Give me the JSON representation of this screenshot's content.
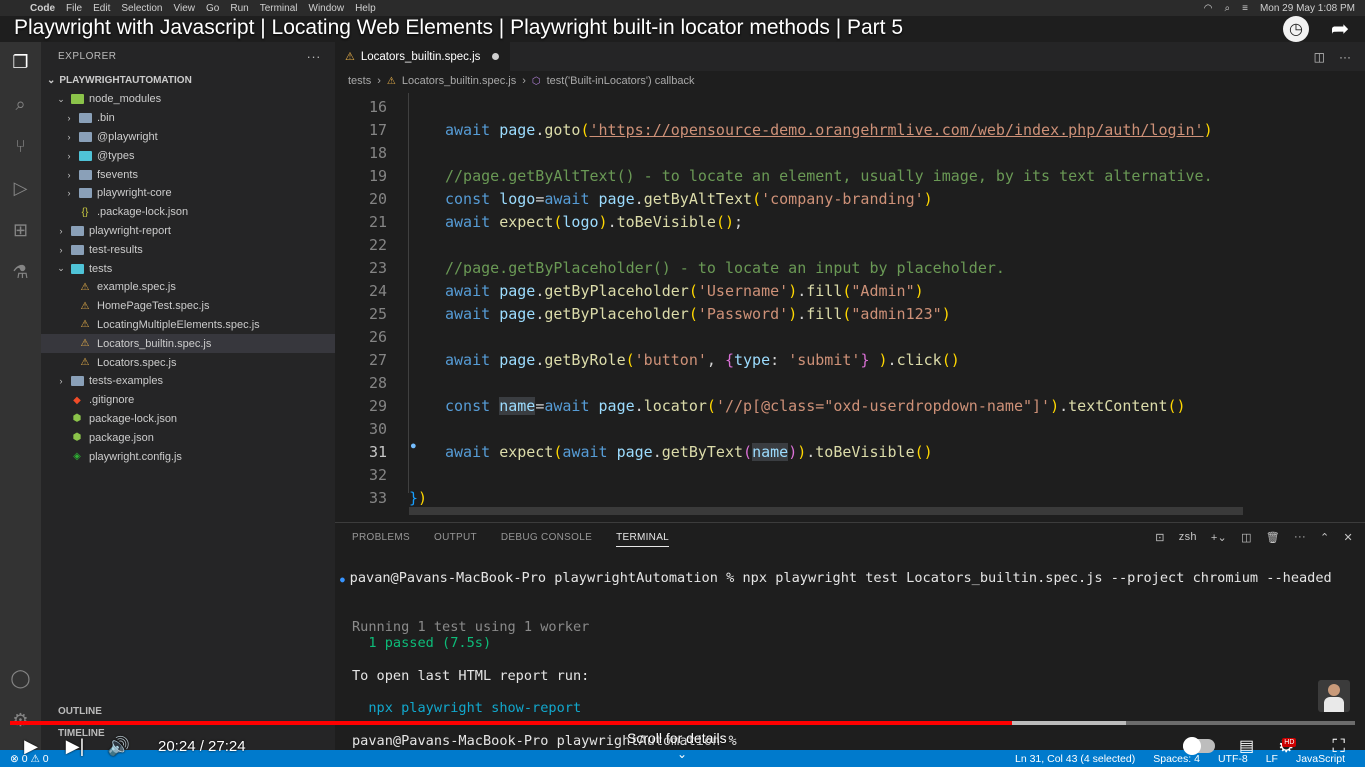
{
  "menubar": {
    "app": "Code",
    "items": [
      "File",
      "Edit",
      "Selection",
      "View",
      "Go",
      "Run",
      "Terminal",
      "Window",
      "Help"
    ],
    "datetime": "Mon 29 May  1:08 PM"
  },
  "video": {
    "title": "Playwright with Javascript | Locating Web Elements | Playwright built-in locator methods | Part 5",
    "current_time": "20:24",
    "duration": "27:24",
    "time_display": "20:24 / 27:24",
    "progress": 0.745,
    "buffered": 0.83,
    "scroll_hint": "Scroll for details",
    "hd_badge": "HD"
  },
  "explorer": {
    "header": "EXPLORER",
    "project": "PLAYWRIGHTAUTOMATION",
    "items": [
      {
        "label": "node_modules",
        "depth": 1,
        "kind": "folder-green",
        "chev": "open"
      },
      {
        "label": ".bin",
        "depth": 2,
        "kind": "folder",
        "chev": "closed"
      },
      {
        "label": "@playwright",
        "depth": 2,
        "kind": "folder",
        "chev": "closed"
      },
      {
        "label": "@types",
        "depth": 2,
        "kind": "folder-teal",
        "chev": "closed"
      },
      {
        "label": "fsevents",
        "depth": 2,
        "kind": "folder",
        "chev": "closed"
      },
      {
        "label": "playwright-core",
        "depth": 2,
        "kind": "folder",
        "chev": "closed"
      },
      {
        "label": ".package-lock.json",
        "depth": 2,
        "kind": "json",
        "chev": "none"
      },
      {
        "label": "playwright-report",
        "depth": 1,
        "kind": "folder",
        "chev": "closed"
      },
      {
        "label": "test-results",
        "depth": 1,
        "kind": "folder",
        "chev": "closed"
      },
      {
        "label": "tests",
        "depth": 1,
        "kind": "folder-teal",
        "chev": "open"
      },
      {
        "label": "example.spec.js",
        "depth": 2,
        "kind": "test",
        "chev": "none"
      },
      {
        "label": "HomePageTest.spec.js",
        "depth": 2,
        "kind": "test",
        "chev": "none"
      },
      {
        "label": "LocatingMultipleElements.spec.js",
        "depth": 2,
        "kind": "test",
        "chev": "none"
      },
      {
        "label": "Locators_builtin.spec.js",
        "depth": 2,
        "kind": "test",
        "chev": "none",
        "selected": true
      },
      {
        "label": "Locators.spec.js",
        "depth": 2,
        "kind": "test",
        "chev": "none"
      },
      {
        "label": "tests-examples",
        "depth": 1,
        "kind": "folder",
        "chev": "closed"
      },
      {
        "label": ".gitignore",
        "depth": 1,
        "kind": "git",
        "chev": "none"
      },
      {
        "label": "package-lock.json",
        "depth": 1,
        "kind": "npm",
        "chev": "none"
      },
      {
        "label": "package.json",
        "depth": 1,
        "kind": "npm",
        "chev": "none"
      },
      {
        "label": "playwright.config.js",
        "depth": 1,
        "kind": "pw",
        "chev": "none"
      }
    ],
    "outline": "OUTLINE",
    "timeline": "TIMELINE"
  },
  "editor": {
    "tab_label": "Locators_builtin.spec.js",
    "breadcrumb": [
      "tests",
      "Locators_builtin.spec.js",
      "test('Built-inLocators') callback"
    ]
  },
  "code_lines": [
    {
      "n": "16",
      "tokens": []
    },
    {
      "n": "17",
      "tokens": [
        [
          "k",
          "await "
        ],
        [
          "v",
          "page"
        ],
        [
          "p",
          "."
        ],
        [
          "f",
          "goto"
        ],
        [
          "b1",
          "("
        ],
        [
          "su",
          "'https://opensource-demo.orangehrmlive.com/web/index.php/auth/login'"
        ],
        [
          "b1",
          ")"
        ]
      ]
    },
    {
      "n": "18",
      "tokens": []
    },
    {
      "n": "19",
      "tokens": [
        [
          "c",
          "//page.getByAltText() - to locate an element, usually image, by its text alternative."
        ]
      ]
    },
    {
      "n": "20",
      "tokens": [
        [
          "k",
          "const "
        ],
        [
          "v",
          "logo"
        ],
        [
          "p",
          "="
        ],
        [
          "k",
          "await "
        ],
        [
          "v",
          "page"
        ],
        [
          "p",
          "."
        ],
        [
          "f",
          "getByAltText"
        ],
        [
          "b1",
          "("
        ],
        [
          "s",
          "'company-branding'"
        ],
        [
          "b1",
          ")"
        ]
      ]
    },
    {
      "n": "21",
      "tokens": [
        [
          "k",
          "await "
        ],
        [
          "f",
          "expect"
        ],
        [
          "b1",
          "("
        ],
        [
          "v",
          "logo"
        ],
        [
          "b1",
          ")"
        ],
        [
          "p",
          "."
        ],
        [
          "f",
          "toBeVisible"
        ],
        [
          "b1",
          "()"
        ],
        [
          "p",
          ";"
        ]
      ]
    },
    {
      "n": "22",
      "tokens": []
    },
    {
      "n": "23",
      "tokens": [
        [
          "c",
          "//page.getByPlaceholder() - to locate an input by placeholder."
        ]
      ]
    },
    {
      "n": "24",
      "tokens": [
        [
          "k",
          "await "
        ],
        [
          "v",
          "page"
        ],
        [
          "p",
          "."
        ],
        [
          "f",
          "getByPlaceholder"
        ],
        [
          "b1",
          "("
        ],
        [
          "s",
          "'Username'"
        ],
        [
          "b1",
          ")"
        ],
        [
          "p",
          "."
        ],
        [
          "f",
          "fill"
        ],
        [
          "b1",
          "("
        ],
        [
          "s",
          "\"Admin\""
        ],
        [
          "b1",
          ")"
        ]
      ]
    },
    {
      "n": "25",
      "tokens": [
        [
          "k",
          "await "
        ],
        [
          "v",
          "page"
        ],
        [
          "p",
          "."
        ],
        [
          "f",
          "getByPlaceholder"
        ],
        [
          "b1",
          "("
        ],
        [
          "s",
          "'Password'"
        ],
        [
          "b1",
          ")"
        ],
        [
          "p",
          "."
        ],
        [
          "f",
          "fill"
        ],
        [
          "b1",
          "("
        ],
        [
          "s",
          "\"admin123\""
        ],
        [
          "b1",
          ")"
        ]
      ]
    },
    {
      "n": "26",
      "tokens": []
    },
    {
      "n": "27",
      "tokens": [
        [
          "k",
          "await "
        ],
        [
          "v",
          "page"
        ],
        [
          "p",
          "."
        ],
        [
          "f",
          "getByRole"
        ],
        [
          "b1",
          "("
        ],
        [
          "s",
          "'button'"
        ],
        [
          "p",
          ", "
        ],
        [
          "b2",
          "{"
        ],
        [
          "v",
          "type"
        ],
        [
          "p",
          ": "
        ],
        [
          "s",
          "'submit'"
        ],
        [
          "b2",
          "}"
        ],
        [
          "p",
          " "
        ],
        [
          "b1",
          ")"
        ],
        [
          "p",
          "."
        ],
        [
          "f",
          "click"
        ],
        [
          "b1",
          "()"
        ]
      ]
    },
    {
      "n": "28",
      "tokens": []
    },
    {
      "n": "29",
      "tokens": [
        [
          "k",
          "const "
        ],
        [
          "vh",
          "name"
        ],
        [
          "p",
          "="
        ],
        [
          "k",
          "await "
        ],
        [
          "v",
          "page"
        ],
        [
          "p",
          "."
        ],
        [
          "f",
          "locator"
        ],
        [
          "b1",
          "("
        ],
        [
          "s",
          "'//p[@class=\"oxd-userdropdown-name\"]'"
        ],
        [
          "b1",
          ")"
        ],
        [
          "p",
          "."
        ],
        [
          "f",
          "textContent"
        ],
        [
          "b1",
          "()"
        ]
      ]
    },
    {
      "n": "30",
      "tokens": []
    },
    {
      "n": "31",
      "tokens": [
        [
          "k",
          "await "
        ],
        [
          "f",
          "expect"
        ],
        [
          "b1",
          "("
        ],
        [
          "k",
          "await "
        ],
        [
          "v",
          "page"
        ],
        [
          "p",
          "."
        ],
        [
          "f",
          "getByText"
        ],
        [
          "b2",
          "("
        ],
        [
          "vh",
          "name"
        ],
        [
          "b2",
          ")"
        ],
        [
          "b1",
          ")"
        ],
        [
          "p",
          "."
        ],
        [
          "f",
          "toBeVisible"
        ],
        [
          "b1",
          "()"
        ]
      ],
      "current": true
    },
    {
      "n": "32",
      "tokens": []
    },
    {
      "n": "33",
      "tokens": [
        [
          "b3",
          "}"
        ],
        [
          "b1",
          ")"
        ]
      ],
      "outdent": true
    }
  ],
  "panel": {
    "tabs": [
      "PROBLEMS",
      "OUTPUT",
      "DEBUG CONSOLE",
      "TERMINAL"
    ],
    "active_tab": "TERMINAL",
    "shell": "zsh",
    "term_lines": [
      {
        "text": "pavan@Pavans-MacBook-Pro playwrightAutomation % npx playwright test Locators_builtin.spec.js --project chromium --headed",
        "cls": "wh",
        "bullet": true
      },
      {
        "text": "",
        "cls": ""
      },
      {
        "text": "",
        "cls": ""
      },
      {
        "text": "Running 1 test using 1 worker",
        "cls": "dim"
      },
      {
        "text": "  1 passed (7.5s)",
        "cls": "gr"
      },
      {
        "text": "",
        "cls": ""
      },
      {
        "text": "To open last HTML report run:",
        "cls": "wh"
      },
      {
        "text": "",
        "cls": ""
      },
      {
        "text": "  npx playwright show-report",
        "cls": "cy"
      },
      {
        "text": "",
        "cls": ""
      },
      {
        "text": "pavan@Pavans-MacBook-Pro playwrightAutomation % ",
        "cls": "wh"
      }
    ]
  },
  "statusbar": {
    "left": "⊗ 0  ⚠ 0",
    "position": "Ln 31, Col 43 (4 selected)",
    "spaces": "Spaces: 4",
    "encoding": "UTF-8",
    "eol": "LF",
    "language": "JavaScript"
  },
  "colors": {
    "accent": "#007acc",
    "yt_red": "#ff0000"
  }
}
